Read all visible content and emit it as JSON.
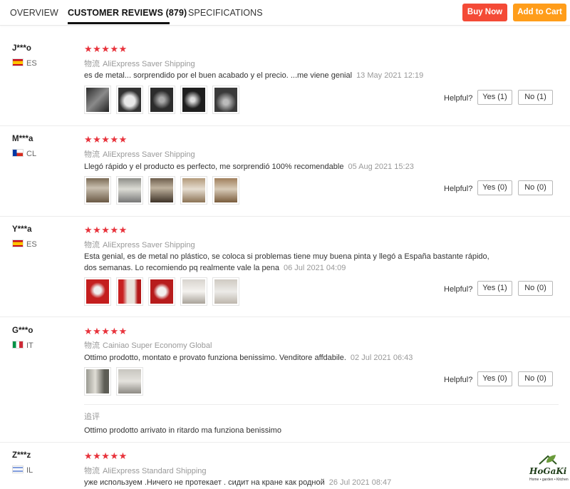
{
  "tabs": {
    "overview": "OVERVIEW",
    "reviews": "CUSTOMER REVIEWS (879)",
    "specifications": "SPECIFICATIONS"
  },
  "buttons": {
    "buy_now": "Buy Now",
    "add_to_cart": "Add to Cart"
  },
  "colors": {
    "buy_now": "#f44a36",
    "add_to_cart": "#ff9d1a",
    "stars": "#e8333c"
  },
  "helpful_label": "Helpful?",
  "ship_prefix": "物流",
  "rating_stars": "★★★★★",
  "reviews": [
    {
      "user": "J***o",
      "country": "ES",
      "shipping": "AliExpress Saver Shipping",
      "text": "es de metal... sorprendido por el buen acabado y el precio. ...me viene genial",
      "date": "13 May 2021 12:19",
      "photos": 5,
      "yes": "Yes (1)",
      "no": "No (1)"
    },
    {
      "user": "M***a",
      "country": "CL",
      "shipping": "AliExpress Saver Shipping",
      "text": "Llegó rápido y el producto es perfecto, me sorprendió 100% recomendable",
      "date": "05 Aug 2021 15:23",
      "photos": 5,
      "yes": "Yes (0)",
      "no": "No (0)"
    },
    {
      "user": "Y***a",
      "country": "ES",
      "shipping": "AliExpress Saver Shipping",
      "text_line1": "Esta genial, es de metal no plástico, se coloca si problemas tiene muy buena pinta y llegó a España bastante rápido,",
      "text_line2": "dos semanas. Lo recomiendo pq realmente vale la pena",
      "date": "06 Jul 2021 04:09",
      "photos": 5,
      "yes": "Yes (1)",
      "no": "No (0)"
    },
    {
      "user": "G***o",
      "country": "IT",
      "shipping": "Cainiao Super Economy Global",
      "text": "Ottimo prodotto, montato e provato funziona benissimo. Venditore affdabile.",
      "date": "02 Jul 2021 06:43",
      "photos": 2,
      "yes": "Yes (0)",
      "no": "No (0)",
      "followup_label": "追评",
      "followup_text": "Ottimo prodotto arrivato in ritardo ma funziona benissimo"
    },
    {
      "user": "Z***z",
      "country": "IL",
      "shipping": "AliExpress Standard Shipping",
      "text": "уже используем .Ничего не протекает . сидит на кране как родной",
      "date": "26 Jul 2021 08:47"
    }
  ],
  "logo": {
    "brand": "HoGaKi",
    "slogan": "Home • garden • Kitchen"
  }
}
